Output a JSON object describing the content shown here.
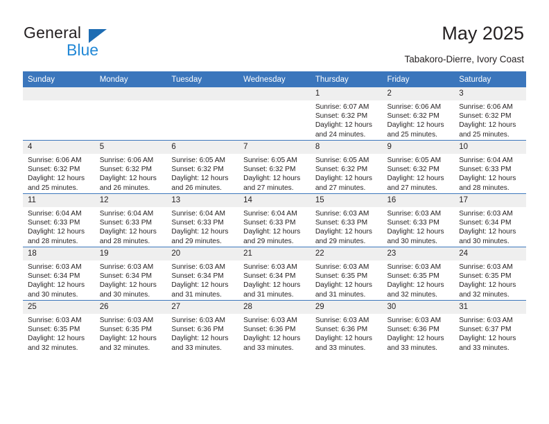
{
  "brand": {
    "line1": "General",
    "line2": "Blue",
    "triangle_icon": "blue-triangle-logo-mark",
    "colors": {
      "general": "#231f20",
      "blue": "#2288d6",
      "triangle": "#1d6cb3"
    }
  },
  "header": {
    "title": "May 2025",
    "subtitle": "Tabakoro-Dierre, Ivory Coast"
  },
  "theme": {
    "header_bg": "#3b76bc",
    "header_text": "#ffffff",
    "daynum_bg": "#efefef",
    "row_divider": "#3b76bc",
    "body_text": "#231f20"
  },
  "weekdays": [
    "Sunday",
    "Monday",
    "Tuesday",
    "Wednesday",
    "Thursday",
    "Friday",
    "Saturday"
  ],
  "weeks": [
    [
      {
        "day": ""
      },
      {
        "day": ""
      },
      {
        "day": ""
      },
      {
        "day": ""
      },
      {
        "day": "1",
        "sunrise": "Sunrise: 6:07 AM",
        "sunset": "Sunset: 6:32 PM",
        "daylight1": "Daylight: 12 hours",
        "daylight2": "and 24 minutes."
      },
      {
        "day": "2",
        "sunrise": "Sunrise: 6:06 AM",
        "sunset": "Sunset: 6:32 PM",
        "daylight1": "Daylight: 12 hours",
        "daylight2": "and 25 minutes."
      },
      {
        "day": "3",
        "sunrise": "Sunrise: 6:06 AM",
        "sunset": "Sunset: 6:32 PM",
        "daylight1": "Daylight: 12 hours",
        "daylight2": "and 25 minutes."
      }
    ],
    [
      {
        "day": "4",
        "sunrise": "Sunrise: 6:06 AM",
        "sunset": "Sunset: 6:32 PM",
        "daylight1": "Daylight: 12 hours",
        "daylight2": "and 25 minutes."
      },
      {
        "day": "5",
        "sunrise": "Sunrise: 6:06 AM",
        "sunset": "Sunset: 6:32 PM",
        "daylight1": "Daylight: 12 hours",
        "daylight2": "and 26 minutes."
      },
      {
        "day": "6",
        "sunrise": "Sunrise: 6:05 AM",
        "sunset": "Sunset: 6:32 PM",
        "daylight1": "Daylight: 12 hours",
        "daylight2": "and 26 minutes."
      },
      {
        "day": "7",
        "sunrise": "Sunrise: 6:05 AM",
        "sunset": "Sunset: 6:32 PM",
        "daylight1": "Daylight: 12 hours",
        "daylight2": "and 27 minutes."
      },
      {
        "day": "8",
        "sunrise": "Sunrise: 6:05 AM",
        "sunset": "Sunset: 6:32 PM",
        "daylight1": "Daylight: 12 hours",
        "daylight2": "and 27 minutes."
      },
      {
        "day": "9",
        "sunrise": "Sunrise: 6:05 AM",
        "sunset": "Sunset: 6:32 PM",
        "daylight1": "Daylight: 12 hours",
        "daylight2": "and 27 minutes."
      },
      {
        "day": "10",
        "sunrise": "Sunrise: 6:04 AM",
        "sunset": "Sunset: 6:33 PM",
        "daylight1": "Daylight: 12 hours",
        "daylight2": "and 28 minutes."
      }
    ],
    [
      {
        "day": "11",
        "sunrise": "Sunrise: 6:04 AM",
        "sunset": "Sunset: 6:33 PM",
        "daylight1": "Daylight: 12 hours",
        "daylight2": "and 28 minutes."
      },
      {
        "day": "12",
        "sunrise": "Sunrise: 6:04 AM",
        "sunset": "Sunset: 6:33 PM",
        "daylight1": "Daylight: 12 hours",
        "daylight2": "and 28 minutes."
      },
      {
        "day": "13",
        "sunrise": "Sunrise: 6:04 AM",
        "sunset": "Sunset: 6:33 PM",
        "daylight1": "Daylight: 12 hours",
        "daylight2": "and 29 minutes."
      },
      {
        "day": "14",
        "sunrise": "Sunrise: 6:04 AM",
        "sunset": "Sunset: 6:33 PM",
        "daylight1": "Daylight: 12 hours",
        "daylight2": "and 29 minutes."
      },
      {
        "day": "15",
        "sunrise": "Sunrise: 6:03 AM",
        "sunset": "Sunset: 6:33 PM",
        "daylight1": "Daylight: 12 hours",
        "daylight2": "and 29 minutes."
      },
      {
        "day": "16",
        "sunrise": "Sunrise: 6:03 AM",
        "sunset": "Sunset: 6:33 PM",
        "daylight1": "Daylight: 12 hours",
        "daylight2": "and 30 minutes."
      },
      {
        "day": "17",
        "sunrise": "Sunrise: 6:03 AM",
        "sunset": "Sunset: 6:34 PM",
        "daylight1": "Daylight: 12 hours",
        "daylight2": "and 30 minutes."
      }
    ],
    [
      {
        "day": "18",
        "sunrise": "Sunrise: 6:03 AM",
        "sunset": "Sunset: 6:34 PM",
        "daylight1": "Daylight: 12 hours",
        "daylight2": "and 30 minutes."
      },
      {
        "day": "19",
        "sunrise": "Sunrise: 6:03 AM",
        "sunset": "Sunset: 6:34 PM",
        "daylight1": "Daylight: 12 hours",
        "daylight2": "and 30 minutes."
      },
      {
        "day": "20",
        "sunrise": "Sunrise: 6:03 AM",
        "sunset": "Sunset: 6:34 PM",
        "daylight1": "Daylight: 12 hours",
        "daylight2": "and 31 minutes."
      },
      {
        "day": "21",
        "sunrise": "Sunrise: 6:03 AM",
        "sunset": "Sunset: 6:34 PM",
        "daylight1": "Daylight: 12 hours",
        "daylight2": "and 31 minutes."
      },
      {
        "day": "22",
        "sunrise": "Sunrise: 6:03 AM",
        "sunset": "Sunset: 6:35 PM",
        "daylight1": "Daylight: 12 hours",
        "daylight2": "and 31 minutes."
      },
      {
        "day": "23",
        "sunrise": "Sunrise: 6:03 AM",
        "sunset": "Sunset: 6:35 PM",
        "daylight1": "Daylight: 12 hours",
        "daylight2": "and 32 minutes."
      },
      {
        "day": "24",
        "sunrise": "Sunrise: 6:03 AM",
        "sunset": "Sunset: 6:35 PM",
        "daylight1": "Daylight: 12 hours",
        "daylight2": "and 32 minutes."
      }
    ],
    [
      {
        "day": "25",
        "sunrise": "Sunrise: 6:03 AM",
        "sunset": "Sunset: 6:35 PM",
        "daylight1": "Daylight: 12 hours",
        "daylight2": "and 32 minutes."
      },
      {
        "day": "26",
        "sunrise": "Sunrise: 6:03 AM",
        "sunset": "Sunset: 6:35 PM",
        "daylight1": "Daylight: 12 hours",
        "daylight2": "and 32 minutes."
      },
      {
        "day": "27",
        "sunrise": "Sunrise: 6:03 AM",
        "sunset": "Sunset: 6:36 PM",
        "daylight1": "Daylight: 12 hours",
        "daylight2": "and 33 minutes."
      },
      {
        "day": "28",
        "sunrise": "Sunrise: 6:03 AM",
        "sunset": "Sunset: 6:36 PM",
        "daylight1": "Daylight: 12 hours",
        "daylight2": "and 33 minutes."
      },
      {
        "day": "29",
        "sunrise": "Sunrise: 6:03 AM",
        "sunset": "Sunset: 6:36 PM",
        "daylight1": "Daylight: 12 hours",
        "daylight2": "and 33 minutes."
      },
      {
        "day": "30",
        "sunrise": "Sunrise: 6:03 AM",
        "sunset": "Sunset: 6:36 PM",
        "daylight1": "Daylight: 12 hours",
        "daylight2": "and 33 minutes."
      },
      {
        "day": "31",
        "sunrise": "Sunrise: 6:03 AM",
        "sunset": "Sunset: 6:37 PM",
        "daylight1": "Daylight: 12 hours",
        "daylight2": "and 33 minutes."
      }
    ]
  ]
}
